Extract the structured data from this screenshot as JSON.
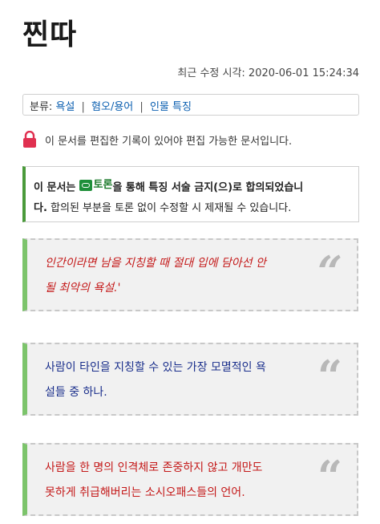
{
  "page": {
    "title": "찐따",
    "last_modified": "최근 수정 시각: 2020-06-01 15:24:34"
  },
  "category": {
    "label": "분류:",
    "items": [
      "욕설",
      "혐오/용어",
      "인물 특징"
    ],
    "separator": "|"
  },
  "edit_lock": {
    "icon": "lock-icon",
    "text": "이 문서를 편집한 기록이 있어야 편집 가능한 문서입니다."
  },
  "notice": {
    "prefix": "이 문서는",
    "discussion_link": "토론",
    "discussion_icon": "discussion-icon",
    "middle": "을 통해 특징 서술 금지(으)로 합의되었습니",
    "line2_bold": "다.",
    "line2_rest": " 합의된 부분을 토론 없이 수정할 시 제재될 수 있습니다.",
    "border_color": "#4a9a3a"
  },
  "quotes": [
    {
      "line1": "인간이라면 남을 지칭할 때 절대 입에 담아선 안",
      "line2": "될 최악의 욕설.'",
      "color": "#c41818",
      "mark": "“"
    },
    {
      "line1": "사람이 타인을 지칭할 수 있는 가장 모멸적인 욕",
      "line2": "설들 중 하나.",
      "color": "#1a2f8c",
      "mark": "“"
    },
    {
      "line1": "사람을 한 명의 인격체로 존중하지 않고 개만도",
      "line2": "못하게 취급해버리는 소시오패스들의 언어.",
      "color": "#c41818",
      "mark": "“"
    }
  ],
  "colors": {
    "quote_border_accent": "#7cc46b",
    "link": "#0b5fb0",
    "lock": "#e03050"
  }
}
